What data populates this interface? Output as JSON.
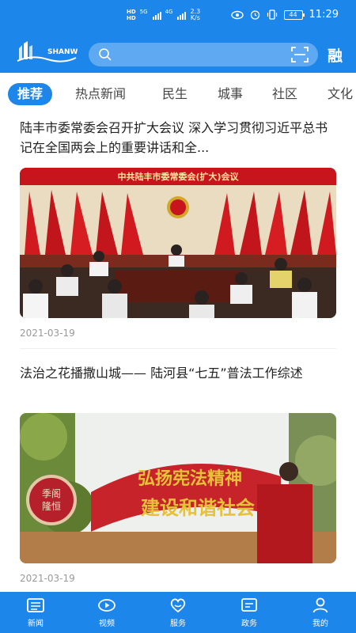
{
  "status_bar": {
    "network_speed": "2.3",
    "network_unit": "K/s",
    "signal_tag_1": "5G",
    "signal_tag_2": "4G",
    "battery": "44",
    "time": "11:29"
  },
  "header": {
    "logo_text": "SHANWEI",
    "side_label": "融"
  },
  "tabs": [
    {
      "label": "推荐",
      "active": true
    },
    {
      "label": "热点新闻",
      "active": false
    },
    {
      "label": "民生",
      "active": false
    },
    {
      "label": "城事",
      "active": false
    },
    {
      "label": "社区",
      "active": false
    },
    {
      "label": "文化",
      "active": false
    }
  ],
  "articles": [
    {
      "title": "陆丰市委常委会召开扩大会议 深入学习贯彻习近平总书记在全国两会上的重要讲话和全...",
      "date": "2021-03-19",
      "image_banner": "中共陆丰市委常委会(扩大)会议"
    },
    {
      "title": "法治之花播撒山城—— 陆河县“七五”普法工作综述",
      "date": "2021-03-19",
      "image_slogan_1": "弘扬宪法精神",
      "image_slogan_2": "建设和谐社会"
    }
  ],
  "bottom_nav": [
    {
      "label": "新闻",
      "icon": "news-icon"
    },
    {
      "label": "视频",
      "icon": "video-icon"
    },
    {
      "label": "服务",
      "icon": "service-icon"
    },
    {
      "label": "政务",
      "icon": "government-icon"
    },
    {
      "label": "我的",
      "icon": "profile-icon"
    }
  ],
  "colors": {
    "primary": "#1c86ea",
    "meeting_red": "#c8141c"
  }
}
